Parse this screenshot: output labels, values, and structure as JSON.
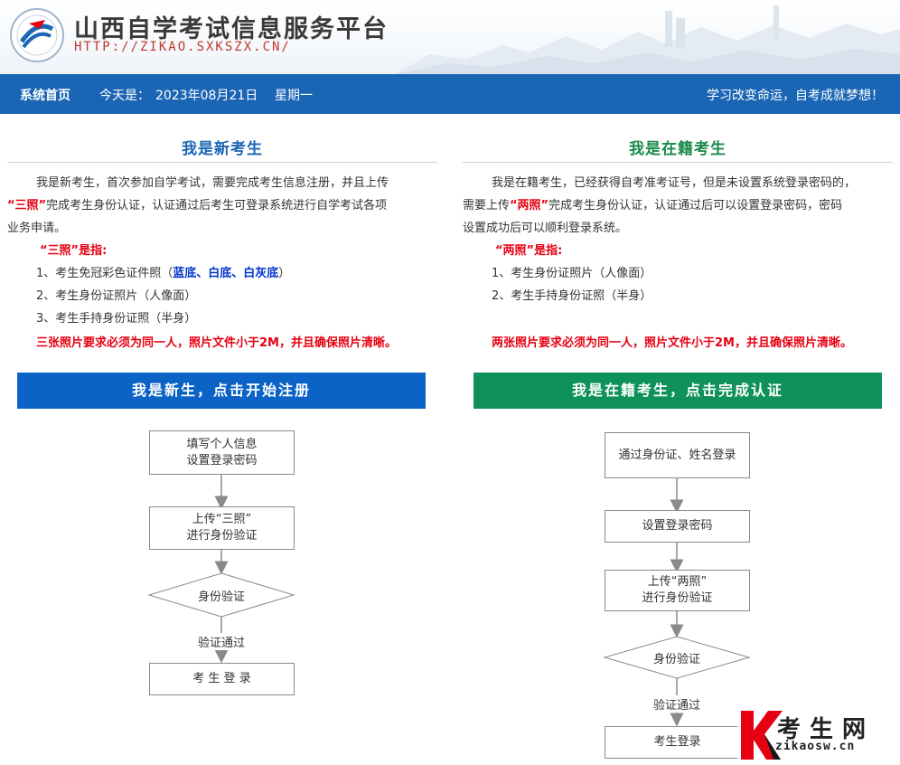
{
  "header": {
    "site_title": "山西自学考试信息服务平台",
    "site_url": "HTTP://ZIKAO.SXKSZX.CN/"
  },
  "navbar": {
    "home": "系统首页",
    "date_label": "今天是：",
    "date": "2023年08月21日",
    "weekday": "星期一",
    "slogan": "学习改变命运，自考成就梦想！"
  },
  "new_candidate": {
    "title": "我是新考生",
    "intro_line1": "我是新考生，首次参加自学考试，需要完成考生信息注册，并且上传",
    "intro_line2_red": "“三照”",
    "intro_line2_rest": "完成考生身份认证，认证通过后考生可登录系统进行自学考试各项",
    "intro_line3": "业务申请。",
    "photos_heading": "“三照”是指:",
    "item1_prefix": "1、考生免冠彩色证件照（",
    "item1_colors": "蓝底、白底、白灰底",
    "item1_suffix": "）",
    "item2": "2、考生身份证照片（人像面）",
    "item3": "3、考生手持身份证照（半身）",
    "notice": "三张照片要求必须为同一人，照片文件小于2M，并且确保照片清晰。",
    "cta": "我是新生，点击开始注册",
    "flow": {
      "step1_line1": "填写个人信息",
      "step1_line2": "设置登录密码",
      "step2_line1": "上传“三照”",
      "step2_line2": "进行身份验证",
      "decision": "身份验证",
      "pass": "验证通过",
      "final": "考 生 登 录"
    }
  },
  "existing_candidate": {
    "title": "我是在籍考生",
    "intro_line1": "我是在籍考生，已经获得自考准考证号，但是未设置系统登录密码的，",
    "intro_line2_pre": "需要上传",
    "intro_line2_red": "“两照”",
    "intro_line2_rest": "完成考生身份认证，认证通过后可以设置登录密码，密码",
    "intro_line3": "设置成功后可以顺利登录系统。",
    "photos_heading": "“两照”是指:",
    "item1": "1、考生身份证照片（人像面）",
    "item2": "2、考生手持身份证照（半身）",
    "notice": "两张照片要求必须为同一人，照片文件小于2M，并且确保照片清晰。",
    "cta": "我是在籍考生，点击完成认证",
    "flow": {
      "step1": "通过身份证、姓名登录",
      "step2": "设置登录密码",
      "step3_line1": "上传“两照”",
      "step3_line2": "进行身份验证",
      "decision": "身份验证",
      "pass": "验证通过",
      "final": "考生登录"
    }
  },
  "watermark": {
    "logo_letter": "K",
    "name": "考生网",
    "url": "zikaosw.cn"
  },
  "colors": {
    "nav_blue": "#1a66b5",
    "cta_blue": "#0b63c6",
    "cta_green": "#0e925a",
    "title_green": "#1a8a4a",
    "red": "#e60012"
  }
}
